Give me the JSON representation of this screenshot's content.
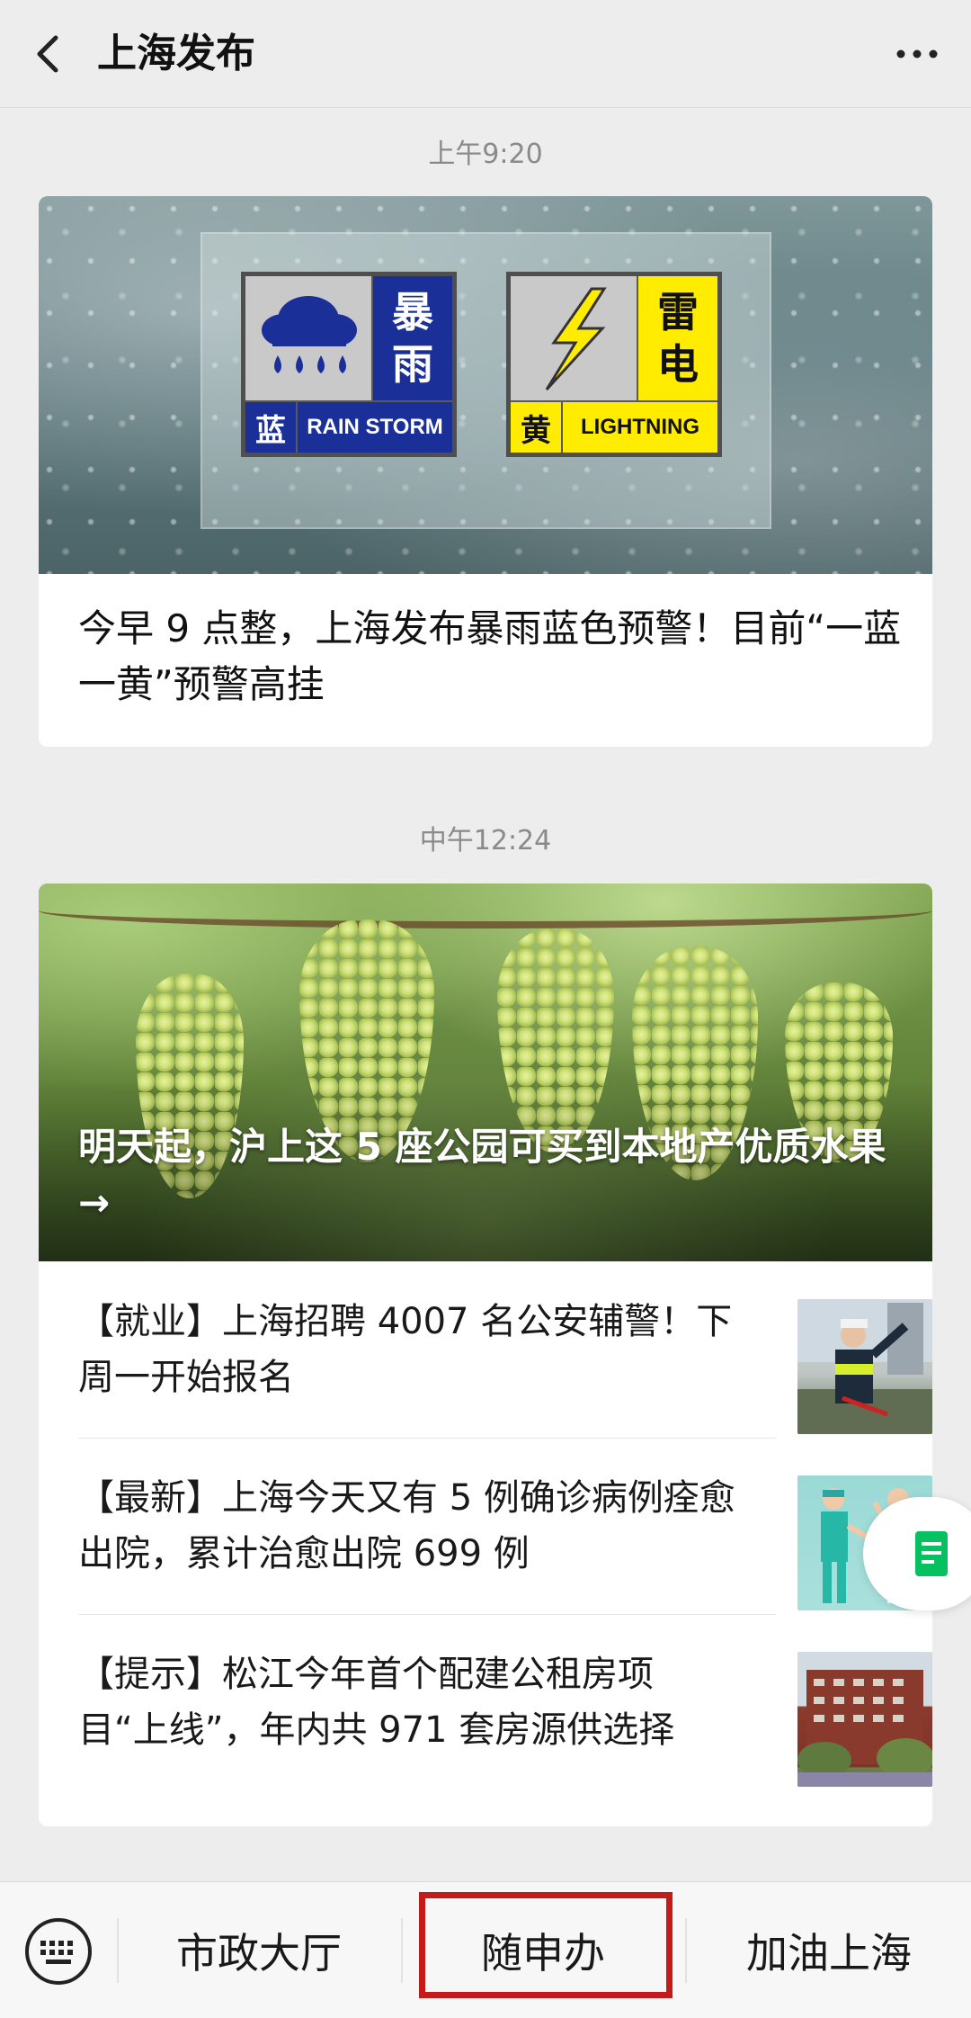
{
  "header": {
    "title": "上海发布",
    "back_icon": "chevron-left-icon",
    "more_icon": "more-dots-icon"
  },
  "feed": [
    {
      "timestamp": "上午9:20",
      "cover": {
        "warnings": [
          {
            "big": [
              "暴",
              "雨"
            ],
            "level": "蓝",
            "english": "RAIN STORM",
            "color": "#1b2f99"
          },
          {
            "big": [
              "雷",
              "电"
            ],
            "level": "黄",
            "english": "LIGHTNING",
            "color": "#ffec00"
          }
        ]
      },
      "title": "今早 9 点整，上海发布暴雨蓝色预警！目前“一蓝一黄”预警高挂"
    },
    {
      "timestamp": "中午12:24",
      "cover_title": "明天起，沪上这 5 座公园可买到本地产优质水果→",
      "articles": [
        {
          "title": "【就业】上海招聘 4007 名公安辅警！下周一开始报名",
          "thumb": "traffic-police-photo"
        },
        {
          "title": "【最新】上海今天又有 5 例确诊病例痊愈出院，累计治愈出院 699 例",
          "thumb": "doctor-illustration"
        },
        {
          "title": "【提示】松江今年首个配建公租房项目“上线”，年内共 971 套房源供选择",
          "thumb": "apartment-building-photo"
        }
      ]
    }
  ],
  "bottom_menu": {
    "keyboard_icon": "keyboard-icon",
    "items": [
      "市政大厅",
      "随申办",
      "加油上海"
    ],
    "highlighted_item": "随申办",
    "highlight_color": "#c41a1a"
  },
  "colors": {
    "background": "#ededed",
    "card": "#ffffff",
    "timestamp": "#8a8a8a",
    "accent_green": "#07c160"
  }
}
